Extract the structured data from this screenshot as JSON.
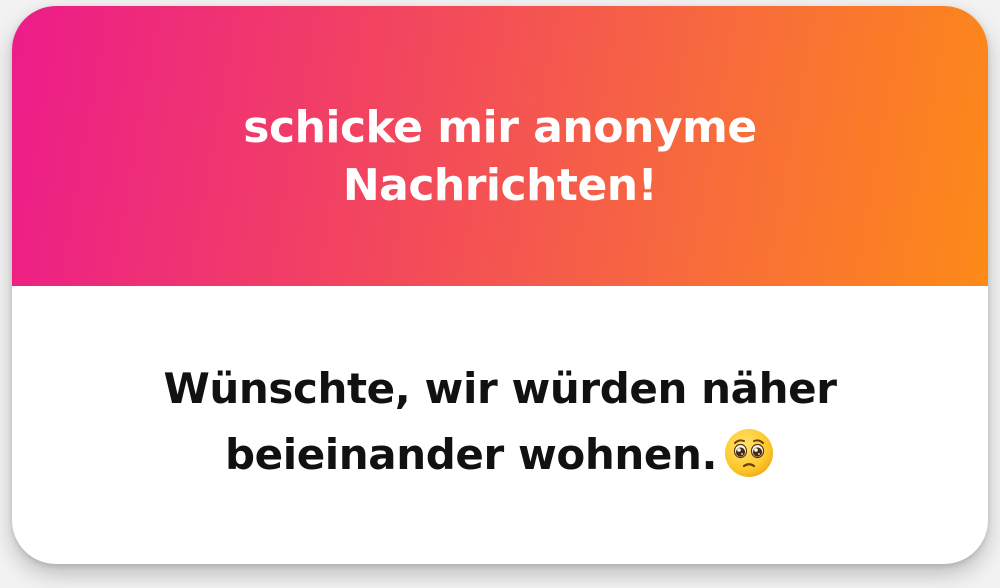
{
  "card": {
    "header_title": "schicke mir anonyme Nachrichten!",
    "message_text": "Wünschte, wir würden näher beieinander wohnen.",
    "message_emoji": "pleading-face-icon"
  },
  "colors": {
    "gradient_start": "#ec1c8a",
    "gradient_end": "#fd8a18",
    "header_text": "#ffffff",
    "message_text": "#111111",
    "card_background": "#ffffff"
  }
}
